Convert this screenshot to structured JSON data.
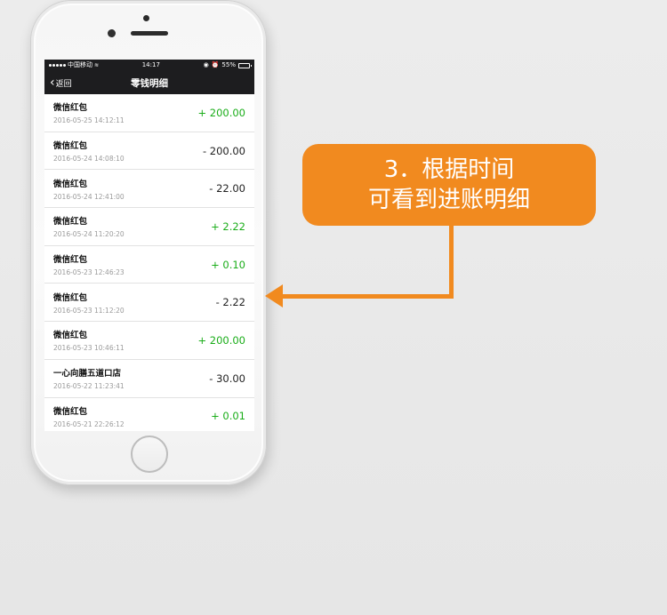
{
  "status_bar": {
    "carrier": "中国移动",
    "time": "14:17",
    "battery": "55%",
    "battery_level": 0.55,
    "icons": [
      "signal-icon",
      "wifi-icon",
      "location-icon",
      "alarm-icon",
      "battery-icon"
    ]
  },
  "nav": {
    "back_label": "返回",
    "title": "零钱明细"
  },
  "transactions": [
    {
      "title": "微信红包",
      "time": "2016-05-25 14:12:11",
      "amount": "+ 200.00",
      "type": "income"
    },
    {
      "title": "微信红包",
      "time": "2016-05-24 14:08:10",
      "amount": "- 200.00",
      "type": "expense"
    },
    {
      "title": "微信红包",
      "time": "2016-05-24 12:41:00",
      "amount": "- 22.00",
      "type": "expense"
    },
    {
      "title": "微信红包",
      "time": "2016-05-24 11:20:20",
      "amount": "+ 2.22",
      "type": "income"
    },
    {
      "title": "微信红包",
      "time": "2016-05-23 12:46:23",
      "amount": "+ 0.10",
      "type": "income"
    },
    {
      "title": "微信红包",
      "time": "2016-05-23 11:12:20",
      "amount": "- 2.22",
      "type": "expense"
    },
    {
      "title": "微信红包",
      "time": "2016-05-23 10:46:11",
      "amount": "+ 200.00",
      "type": "income"
    },
    {
      "title": "一心向膳五道口店",
      "time": "2016-05-22 11:23:41",
      "amount": "- 30.00",
      "type": "expense"
    },
    {
      "title": "微信红包",
      "time": "2016-05-21 22:26:12",
      "amount": "+ 0.01",
      "type": "income"
    }
  ],
  "callout": {
    "line1": "3．根据时间",
    "line2": "可看到进账明细"
  },
  "colors": {
    "accent_orange": "#f18a1f",
    "income_green": "#1aad19",
    "expense_text": "#222222",
    "navbar_bg": "#1d1d1f"
  }
}
